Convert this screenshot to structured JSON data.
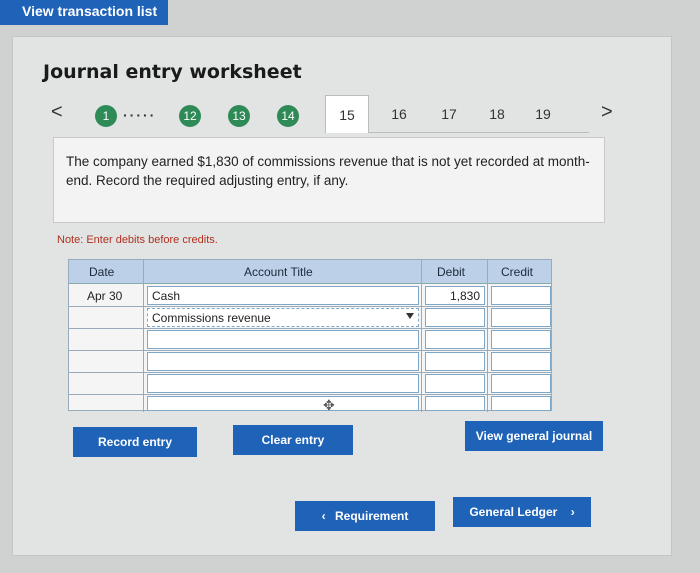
{
  "top_button": {
    "label": "View transaction list"
  },
  "worksheet": {
    "title": "Journal entry worksheet",
    "nav": {
      "prev": "<",
      "next": ">",
      "circles": [
        "1",
        "12",
        "13",
        "14"
      ],
      "dots": "·····",
      "tabs": [
        "15",
        "16",
        "17",
        "18",
        "19"
      ],
      "active_tab": "15"
    },
    "question": "The company earned $1,830 of commissions revenue that is not yet recorded at month-end. Record the required adjusting entry, if any.",
    "note": "Note: Enter debits before credits.",
    "table": {
      "headers": {
        "date": "Date",
        "account": "Account Title",
        "debit": "Debit",
        "credit": "Credit"
      },
      "rows": [
        {
          "date": "Apr 30",
          "account": "Cash",
          "debit": "1,830",
          "credit": ""
        },
        {
          "date": "",
          "account": "Commissions revenue",
          "debit": "",
          "credit": ""
        },
        {
          "date": "",
          "account": "",
          "debit": "",
          "credit": ""
        },
        {
          "date": "",
          "account": "",
          "debit": "",
          "credit": ""
        },
        {
          "date": "",
          "account": "",
          "debit": "",
          "credit": ""
        },
        {
          "date": "",
          "account": "",
          "debit": "",
          "credit": ""
        }
      ]
    },
    "buttons": {
      "record": "Record entry",
      "clear": "Clear entry",
      "view_journal": "View general journal",
      "requirement": "Requirement",
      "general_ledger": "General Ledger"
    }
  }
}
